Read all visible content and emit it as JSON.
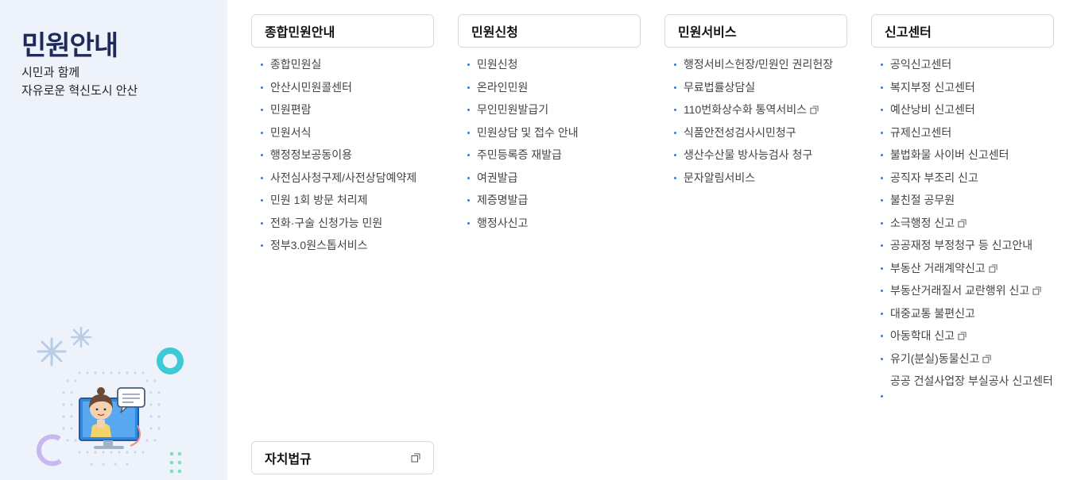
{
  "sidebar": {
    "title": "민원안내",
    "subtitle_line1": "시민과 함께",
    "subtitle_line2": "자유로운 혁신도시 안산"
  },
  "columns": [
    {
      "heading": "종합민원안내",
      "items": [
        {
          "label": "종합민원실"
        },
        {
          "label": "안산시민원콜센터"
        },
        {
          "label": "민원편람"
        },
        {
          "label": "민원서식"
        },
        {
          "label": "행정정보공동이용"
        },
        {
          "label": "사전심사청구제/사전상담예약제"
        },
        {
          "label": "민원 1회 방문 처리제"
        },
        {
          "label": "전화·구술 신청가능 민원"
        },
        {
          "label": "정부3.0원스톱서비스"
        }
      ]
    },
    {
      "heading": "민원신청",
      "items": [
        {
          "label": "민원신청"
        },
        {
          "label": "온라인민원"
        },
        {
          "label": "무인민원발급기"
        },
        {
          "label": "민원상담 및 접수 안내"
        },
        {
          "label": "주민등록증 재발급"
        },
        {
          "label": "여권발급"
        },
        {
          "label": "제증명발급"
        },
        {
          "label": "행정사신고"
        }
      ]
    },
    {
      "heading": "민원서비스",
      "items": [
        {
          "label": "행정서비스헌장/민원인 권리헌장"
        },
        {
          "label": "무료법률상담실"
        },
        {
          "label": "110번화상수화 통역서비스",
          "external": true
        },
        {
          "label": "식품안전성검사시민청구"
        },
        {
          "label": "생산수산물 방사능검사 청구"
        },
        {
          "label": "문자알림서비스"
        }
      ]
    },
    {
      "heading": "신고센터",
      "items": [
        {
          "label": "공익신고센터"
        },
        {
          "label": "복지부정 신고센터"
        },
        {
          "label": "예산낭비 신고센터"
        },
        {
          "label": "규제신고센터"
        },
        {
          "label": "불법화물 사이버 신고센터"
        },
        {
          "label": "공직자 부조리 신고"
        },
        {
          "label": "불친절 공무원"
        },
        {
          "label": "소극행정 신고",
          "external": true
        },
        {
          "label": "공공재정 부정청구 등 신고안내"
        },
        {
          "label": "부동산 거래계약신고",
          "external": true
        },
        {
          "label": "부동산거래질서 교란행위 신고",
          "external": true
        },
        {
          "label": "대중교통 불편신고"
        },
        {
          "label": "아동학대 신고",
          "external": true
        },
        {
          "label": "유기(분실)동물신고",
          "external": true
        },
        {
          "label": "공공 건설사업장 부실공사 신고센터",
          "multiline": true
        }
      ]
    }
  ],
  "bottom_box": {
    "heading": "자치법규",
    "external": true
  },
  "icons": {
    "external_link": "external-link-icon",
    "bullet": "bullet-dot"
  },
  "colors": {
    "sidebar_bg": "#eef3fb",
    "title": "#1d2a5a",
    "bullet": "#3a78d4",
    "border": "#d6d9de"
  }
}
